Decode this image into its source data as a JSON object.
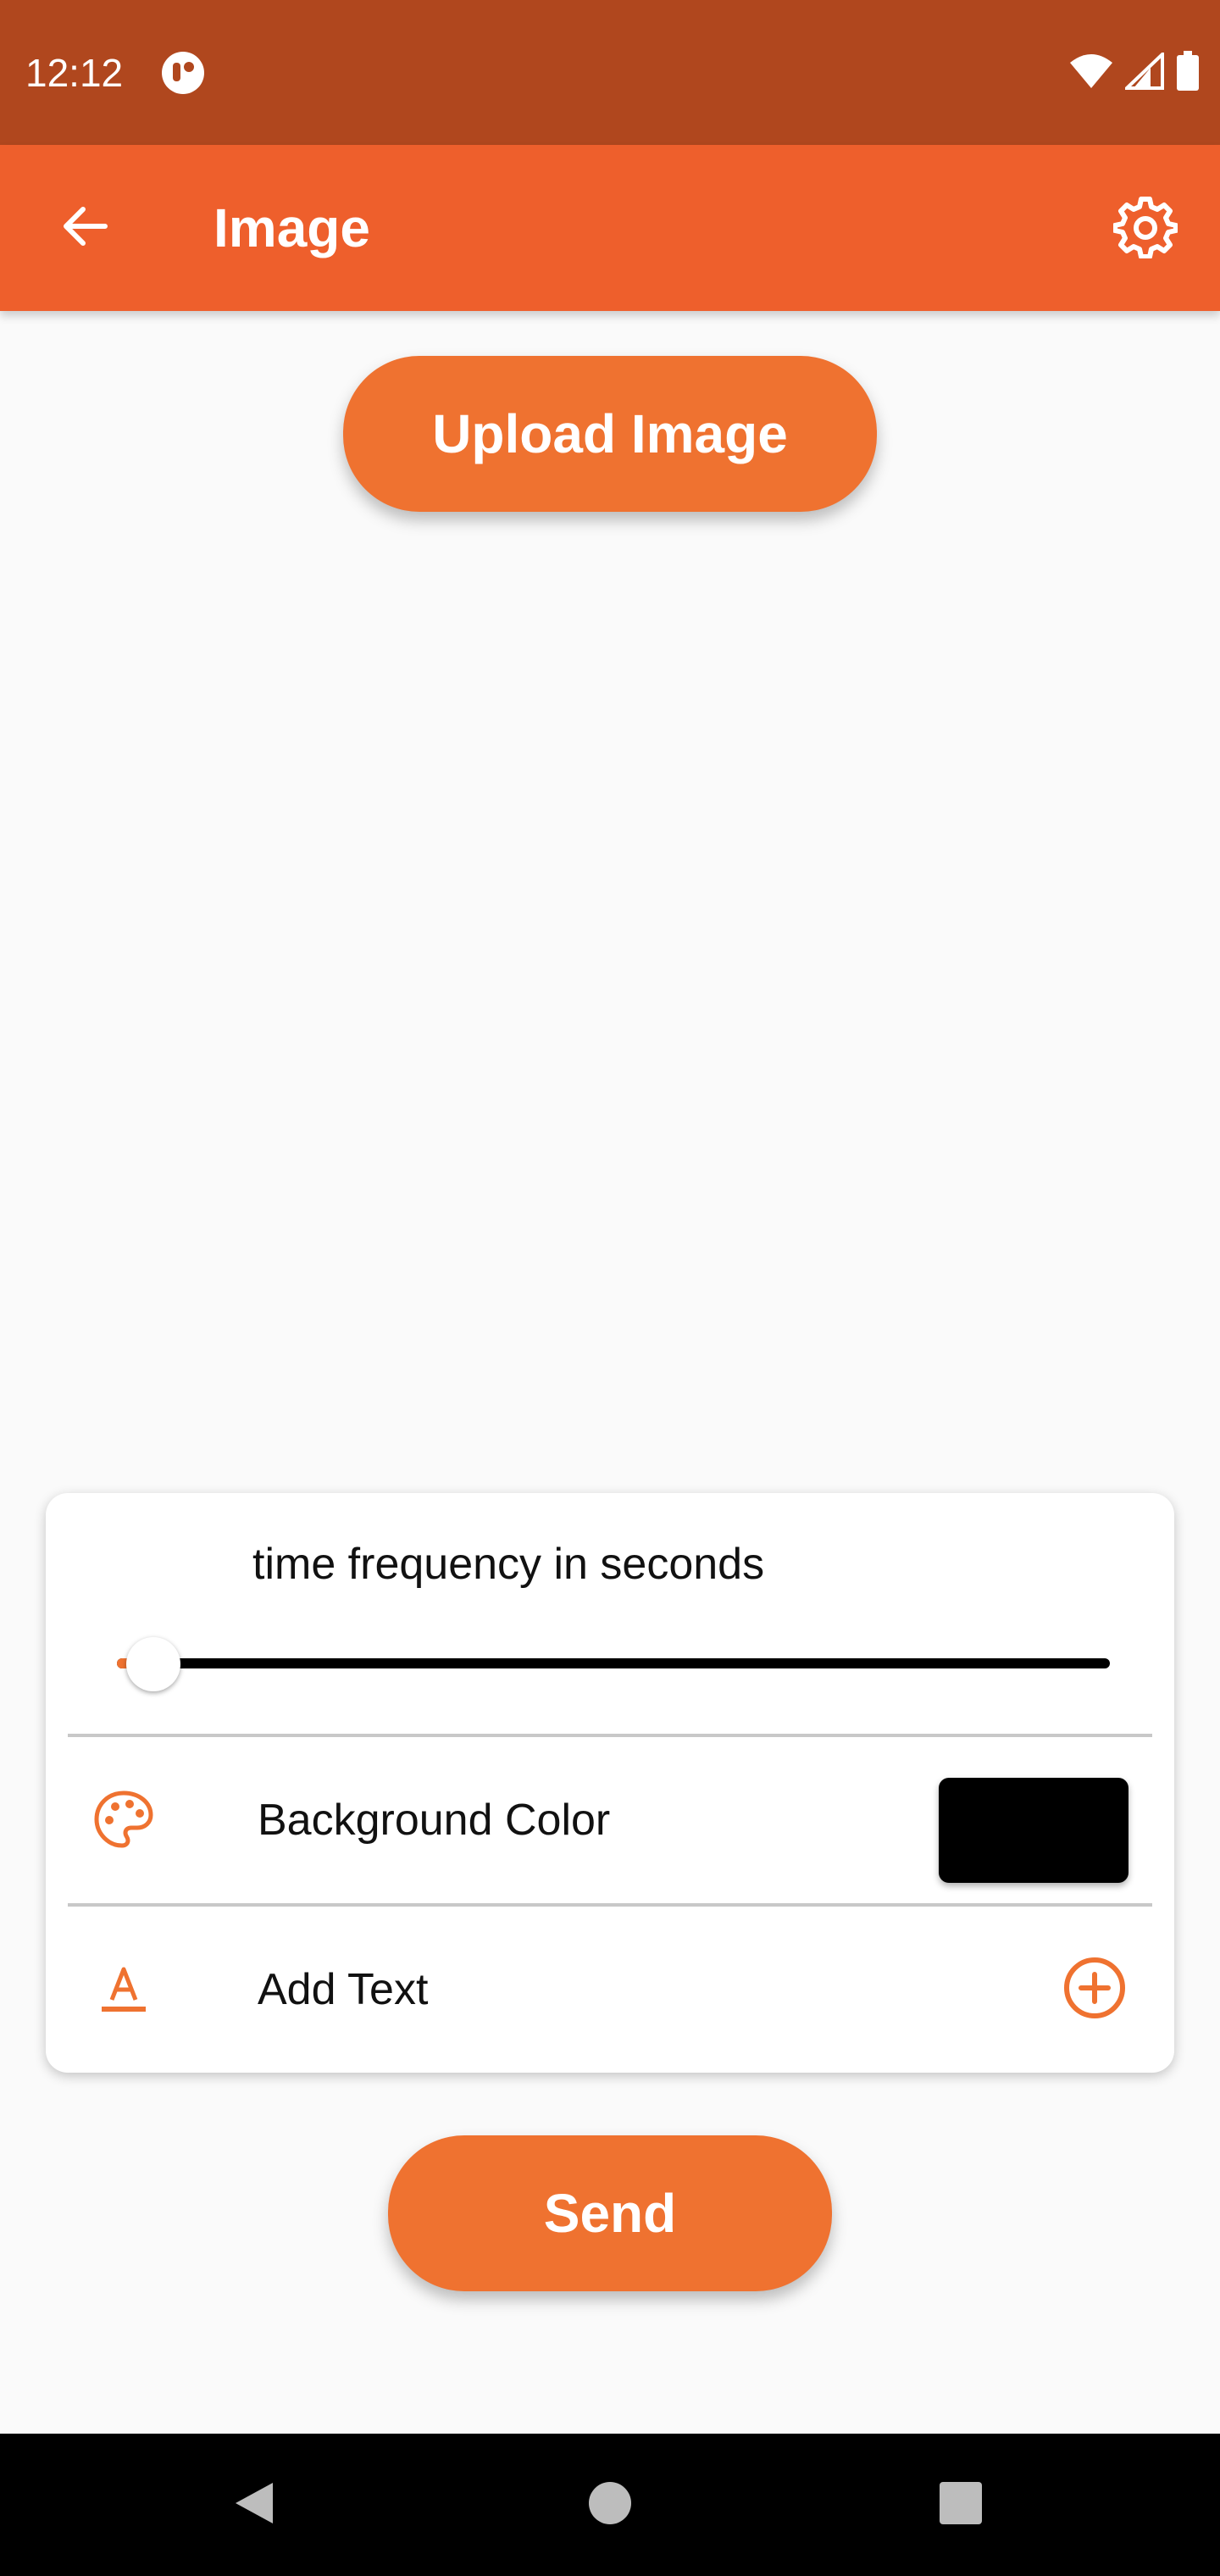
{
  "status_bar": {
    "time": "12:12"
  },
  "app_bar": {
    "title": "Image",
    "back_icon": "arrow-left-icon",
    "settings_icon": "gear-icon"
  },
  "upload_button_label": "Upload Image",
  "card": {
    "frequency_label": "time frequency in seconds",
    "frequency_slider_fraction": 0.02,
    "background_color_label": "Background Color",
    "background_color_value": "#000000",
    "palette_icon": "palette-icon",
    "add_text_label": "Add Text",
    "text_icon": "text-format-icon",
    "add_icon": "add-circle-icon"
  },
  "send_button_label": "Send",
  "colors": {
    "status_bar": "#b0471e",
    "app_bar": "#ee5f2c",
    "accent": "#ef7230",
    "background": "#fafafa"
  },
  "nav_bar": {
    "back_icon": "nav-back-icon",
    "home_icon": "nav-home-icon",
    "recents_icon": "nav-recents-icon"
  }
}
